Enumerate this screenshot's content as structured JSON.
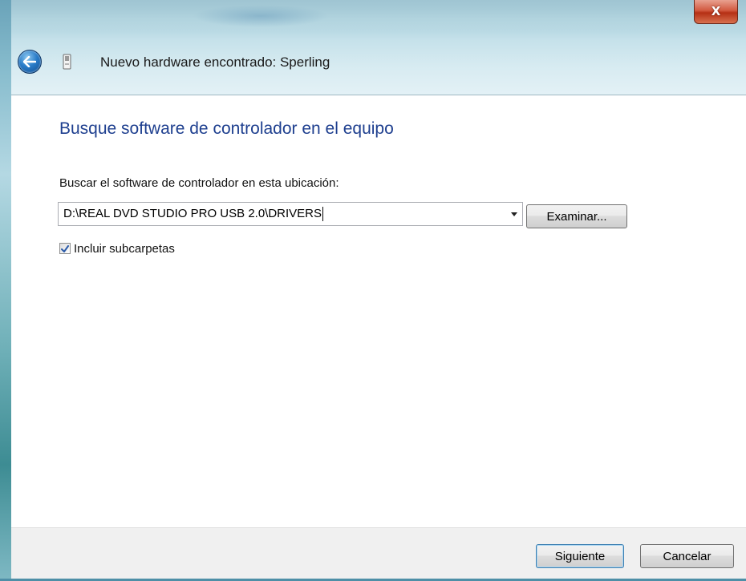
{
  "window": {
    "title": "Nuevo hardware encontrado: Sperling",
    "close_symbol": "X",
    "back_icon": "back-arrow-icon",
    "device_icon": "usb-device-icon"
  },
  "content": {
    "heading": "Busque software de controlador en el equipo",
    "location_label": "Buscar el software de controlador en esta ubicación:",
    "path_value": "D:\\REAL DVD STUDIO PRO USB 2.0\\DRIVERS",
    "browse_label": "Examinar...",
    "include_subfolders": {
      "label": "Incluir subcarpetas",
      "checked": true
    }
  },
  "footer": {
    "next_label": "Siguiente",
    "cancel_label": "Cancelar"
  },
  "colors": {
    "heading": "#1e3f8f",
    "chrome_top": "#7fb1c3",
    "close_button": "#c8462a"
  }
}
